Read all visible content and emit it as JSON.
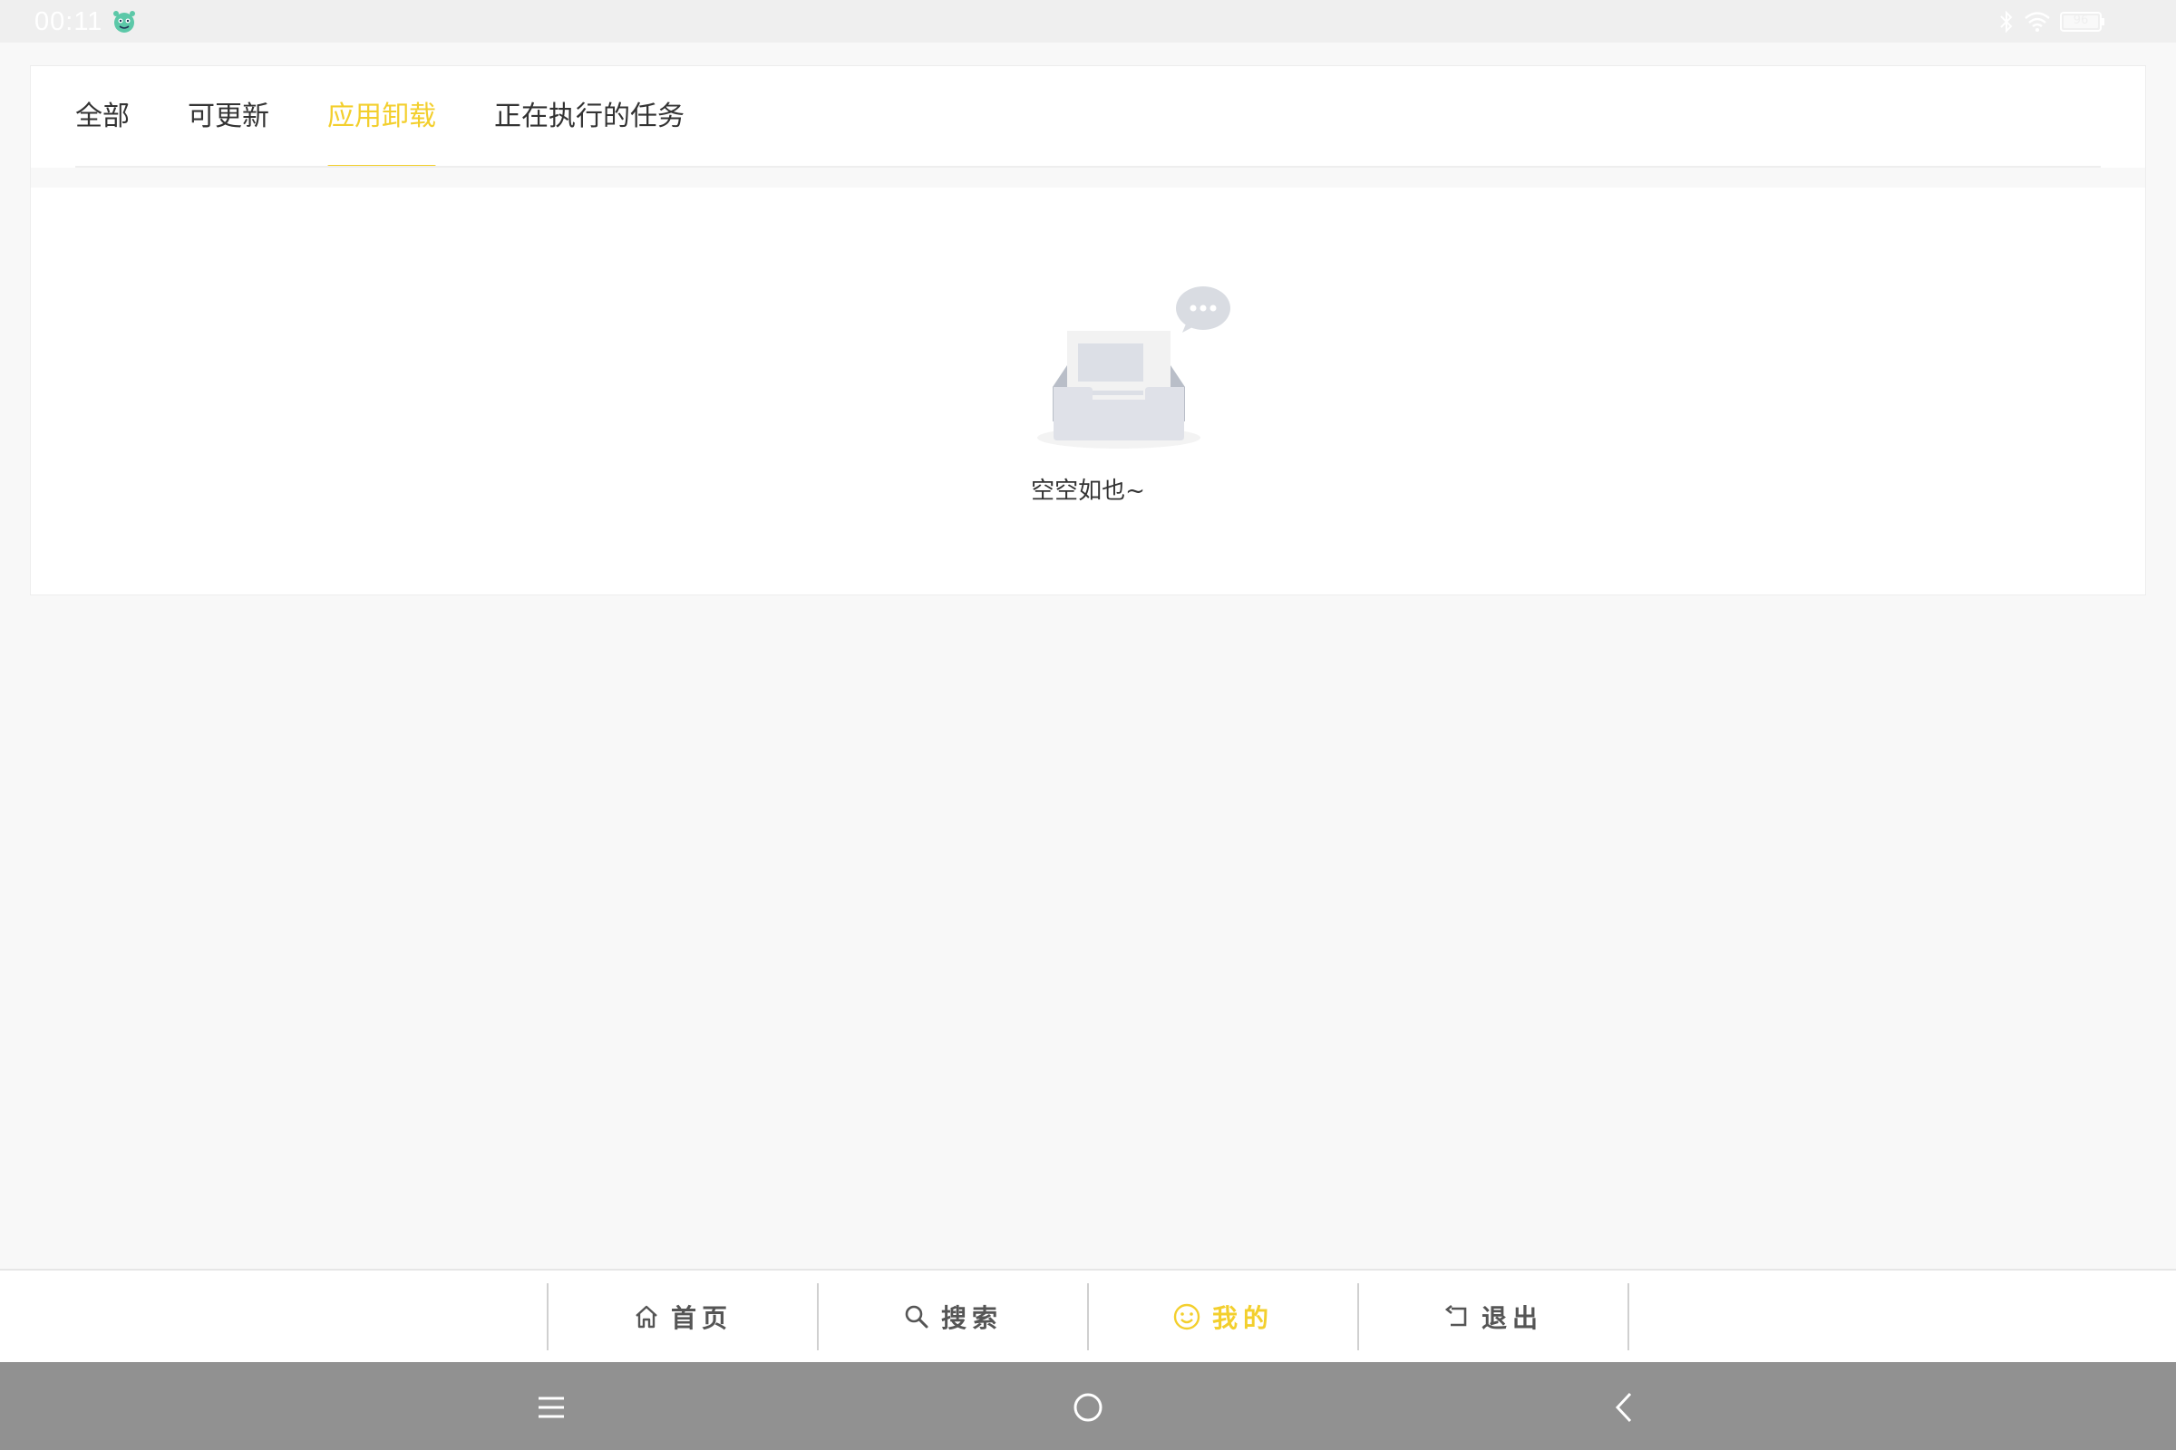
{
  "status_bar": {
    "time": "00:11",
    "battery": "96",
    "icons": [
      "bluetooth-icon",
      "wifi-icon",
      "battery-icon"
    ]
  },
  "tabs": [
    {
      "label": "全部",
      "active": false
    },
    {
      "label": "可更新",
      "active": false
    },
    {
      "label": "应用卸载",
      "active": true
    },
    {
      "label": "正在执行的任务",
      "active": false
    }
  ],
  "empty_state": {
    "text": "空空如也~"
  },
  "bottom_nav": [
    {
      "label": "首页",
      "icon": "home-icon",
      "active": false
    },
    {
      "label": "搜索",
      "icon": "search-icon",
      "active": false
    },
    {
      "label": "我的",
      "icon": "smiley-icon",
      "active": true
    },
    {
      "label": "退出",
      "icon": "exit-icon",
      "active": false
    }
  ],
  "colors": {
    "accent": "#f3cf2d",
    "system_bar": "#919191",
    "background": "#f8f8f8"
  }
}
